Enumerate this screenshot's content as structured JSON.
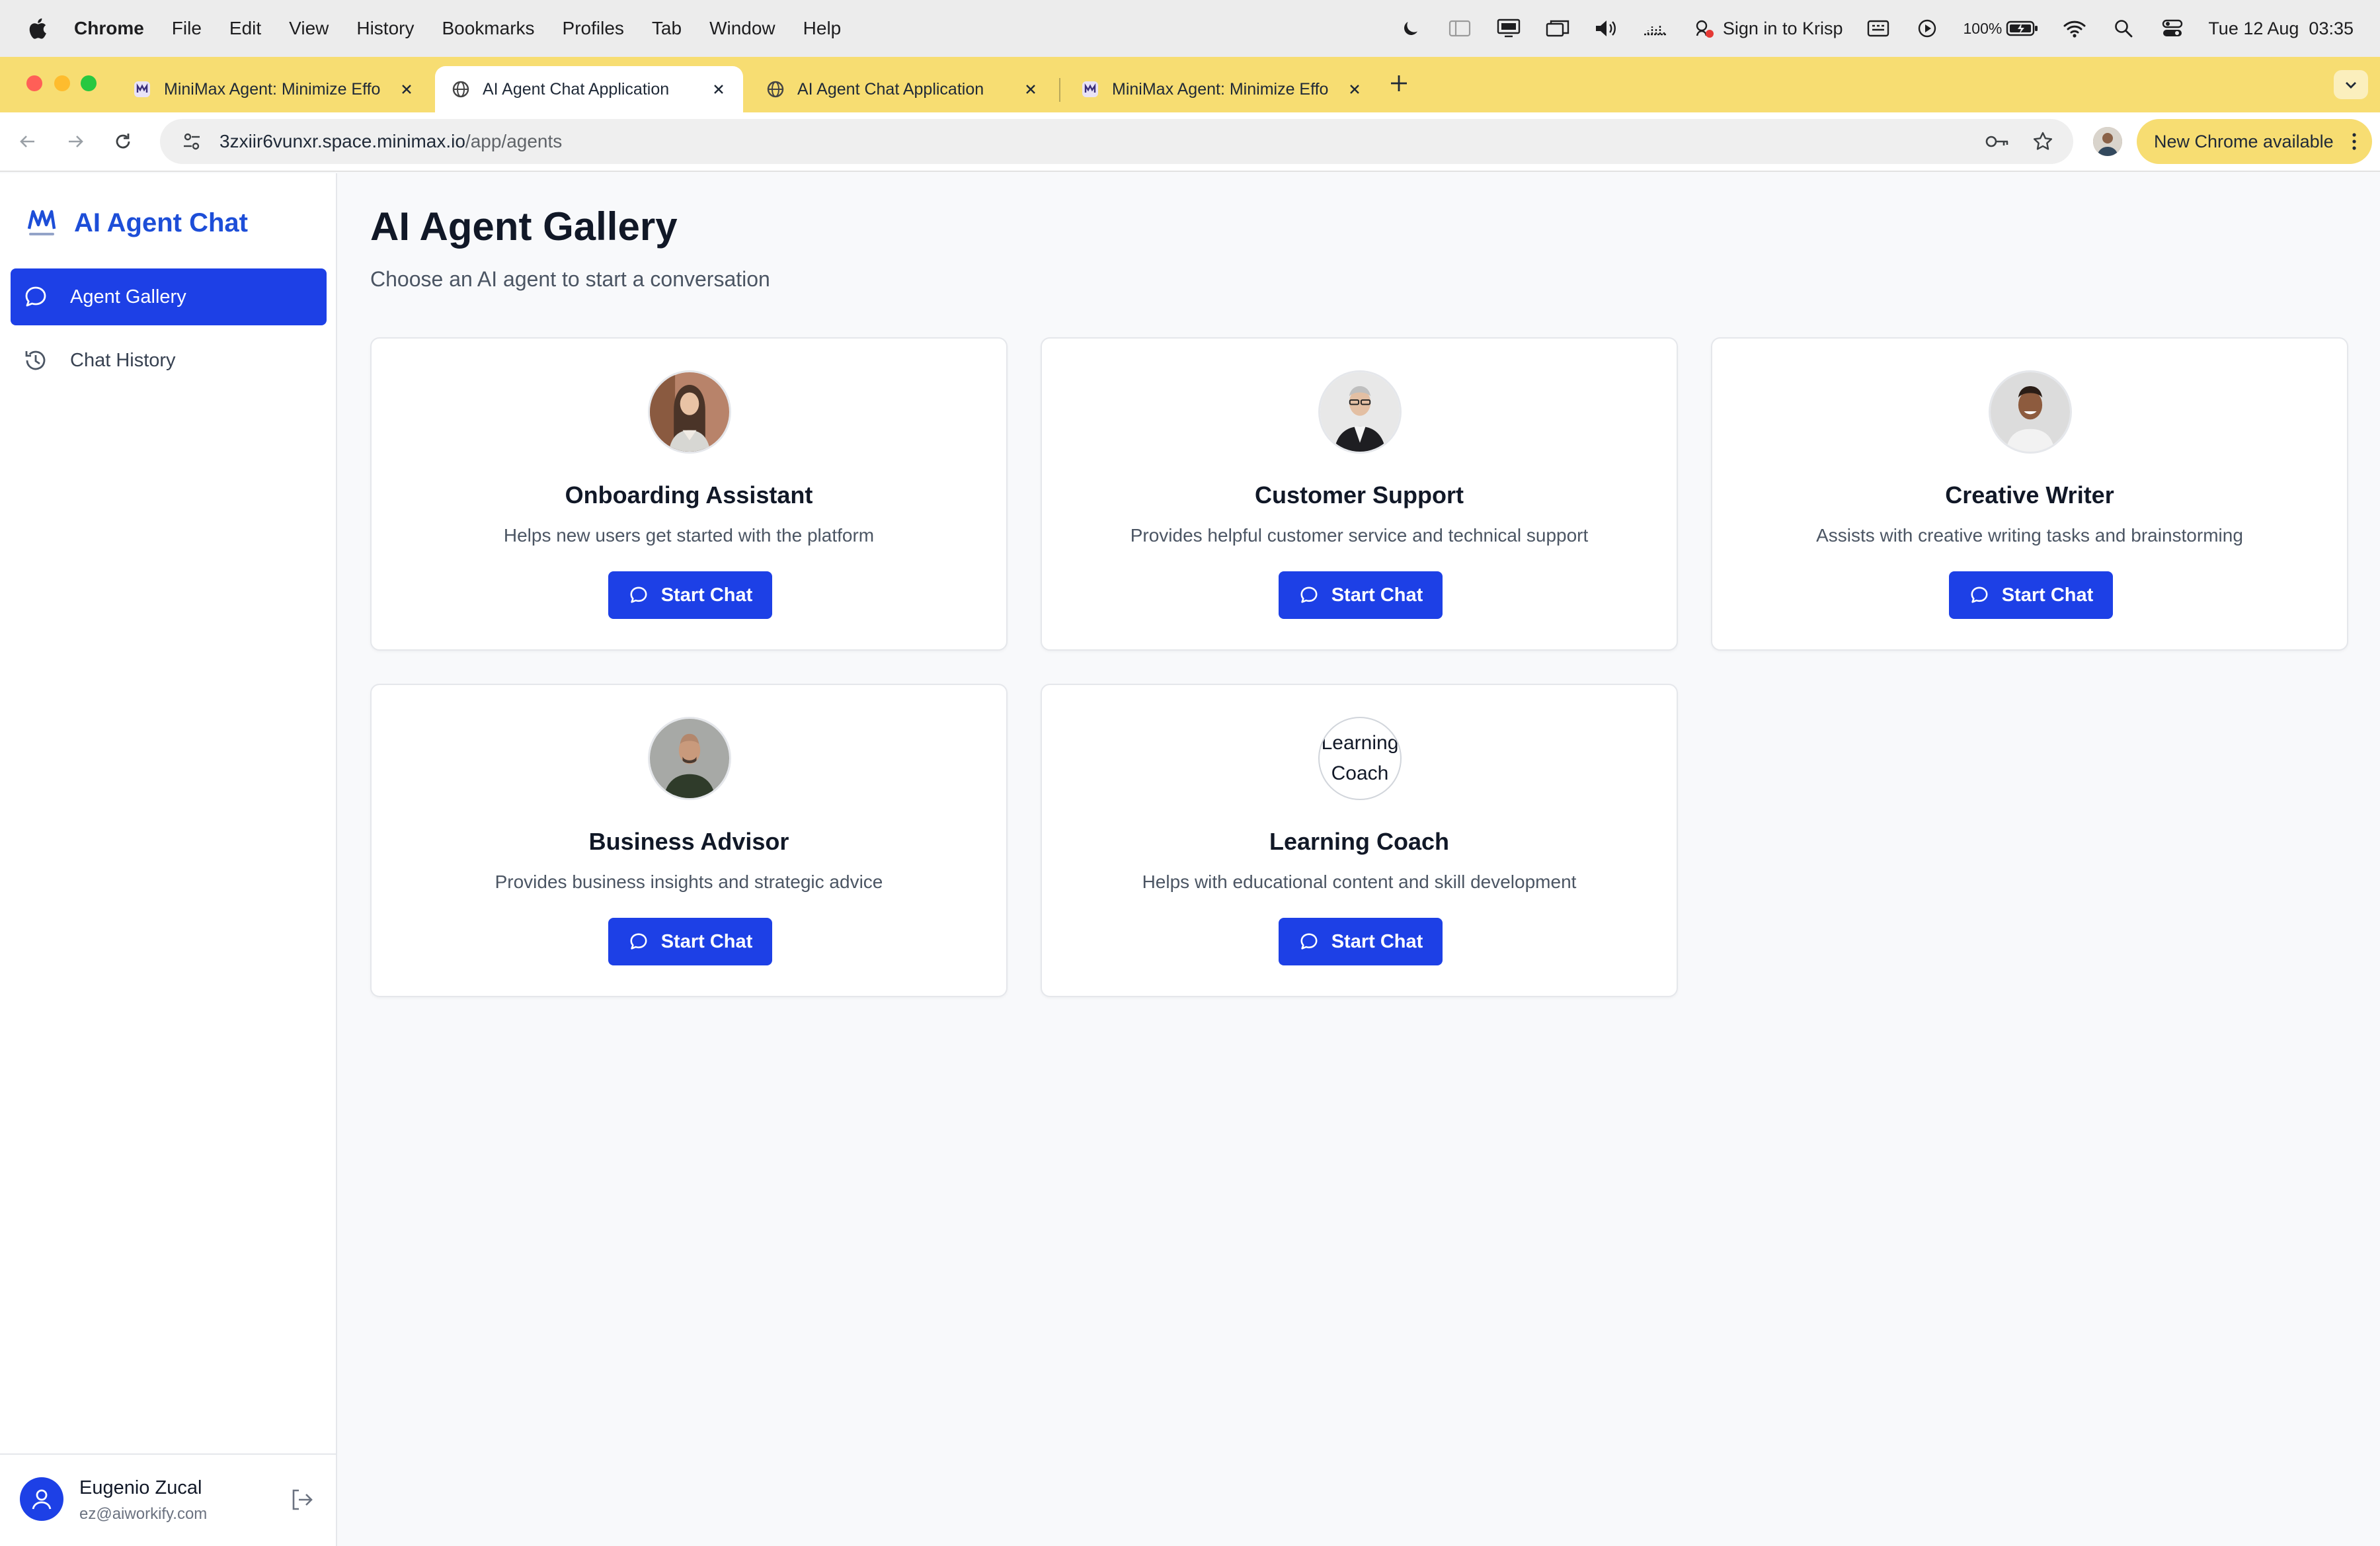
{
  "menubar": {
    "app_name": "Chrome",
    "items": [
      "File",
      "Edit",
      "View",
      "History",
      "Bookmarks",
      "Profiles",
      "Tab",
      "Window",
      "Help"
    ],
    "krisp_label": "Sign in to Krisp",
    "battery": "100%",
    "datetime": "Tue 12 Aug  03:35"
  },
  "tabs": [
    {
      "title": "MiniMax Agent: Minimize Effo",
      "active": false
    },
    {
      "title": "AI Agent Chat Application",
      "active": true
    },
    {
      "title": "AI Agent Chat Application",
      "active": false
    },
    {
      "title": "MiniMax Agent: Minimize Effo",
      "active": false
    }
  ],
  "toolbar": {
    "url_host": "3zxiir6vunxr.space.minimax.io",
    "url_path": "/app/agents",
    "update_label": "New Chrome available"
  },
  "sidebar": {
    "brand": "AI Agent Chat",
    "items": [
      {
        "label": "Agent Gallery",
        "active": true
      },
      {
        "label": "Chat History",
        "active": false
      }
    ],
    "user": {
      "name": "Eugenio Zucal",
      "email": "ez@aiworkify.com"
    }
  },
  "main": {
    "title": "AI Agent Gallery",
    "subtitle": "Choose an AI agent to start a conversation",
    "agents": [
      {
        "name": "Onboarding Assistant",
        "description": "Helps new users get started with the platform",
        "button": "Start Chat"
      },
      {
        "name": "Customer Support",
        "description": "Provides helpful customer service and technical support",
        "button": "Start Chat"
      },
      {
        "name": "Creative Writer",
        "description": "Assists with creative writing tasks and brainstorming",
        "button": "Start Chat"
      },
      {
        "name": "Business Advisor",
        "description": "Provides business insights and strategic advice",
        "button": "Start Chat"
      },
      {
        "name": "Learning Coach",
        "description": "Helps with educational content and skill development",
        "button": "Start Chat",
        "avatar_alt_line1": "Learning",
        "avatar_alt_line2": "Coach"
      }
    ]
  },
  "colors": {
    "accent": "#1d40e6",
    "brand_text": "#1d4ed8",
    "tab_strip": "#f7dd72"
  }
}
